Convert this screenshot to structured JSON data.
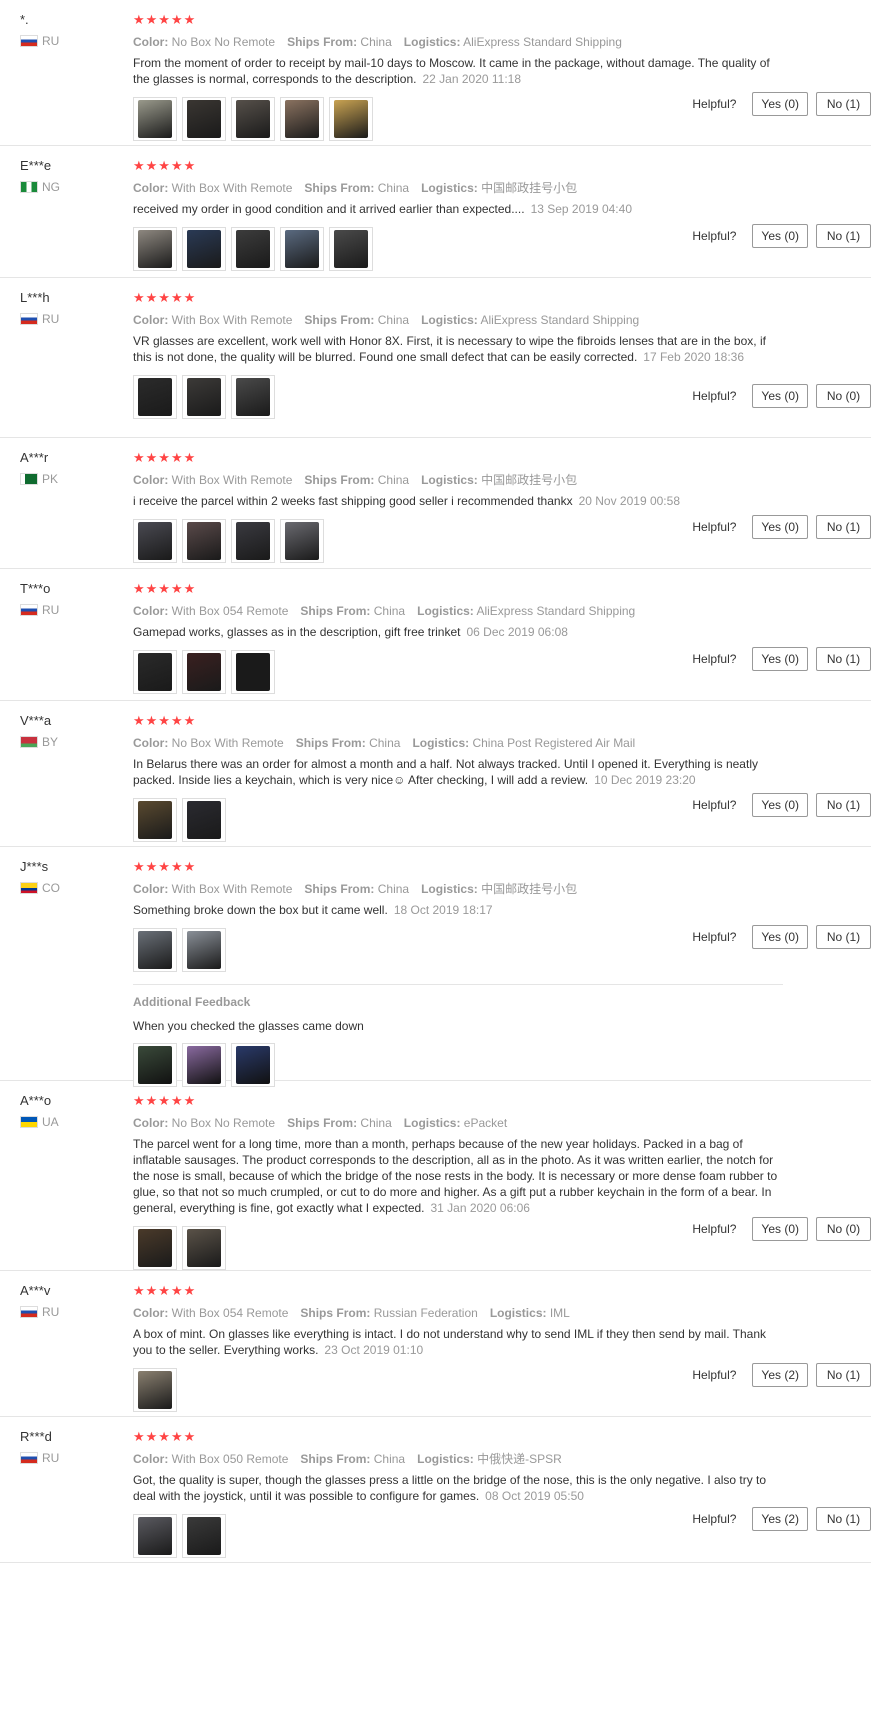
{
  "helpful_label": "Helpful?",
  "meta_labels": {
    "color": "Color:",
    "ships": "Ships From:",
    "logistics": "Logistics:"
  },
  "stars": "★★★★★",
  "reviews": [
    {
      "user": "*.",
      "country": "RU",
      "flag": [
        "#fff",
        "#1f4fb0",
        "#d52b1e"
      ],
      "color": "No Box No Remote",
      "ships": "China",
      "logistics": "AliExpress Standard Shipping",
      "text": "From the moment of order to receipt by mail-10 days to Moscow. It came in the package, without damage. The quality of the glasses is normal, corresponds to the description.",
      "date": "22 Jan 2020 11:18",
      "photos": [
        "#9a9a8c",
        "#3a3632",
        "#56504a",
        "#8a7260",
        "#c9a352"
      ],
      "yes": "Yes (0)",
      "no": "No (1)"
    },
    {
      "user": "E***e",
      "country": "NG",
      "flag": [
        "#1a8a3a",
        "#fff",
        "#1a8a3a"
      ],
      "color": "With Box With Remote",
      "ships": "China",
      "logistics": "中国邮政挂号小包",
      "text": "received my order in good condition and it arrived earlier than expected....",
      "date": "13 Sep 2019 04:40",
      "photos": [
        "#8e8880",
        "#2a3a55",
        "#3c3c3c",
        "#5a6a80",
        "#4a4a4a"
      ],
      "yes": "Yes (0)",
      "no": "No (1)"
    },
    {
      "user": "L***h",
      "country": "RU",
      "flag": [
        "#fff",
        "#1f4fb0",
        "#d52b1e"
      ],
      "color": "With Box With Remote",
      "ships": "China",
      "logistics": "AliExpress Standard Shipping",
      "text": "VR glasses are excellent, work well with Honor 8X. First, it is necessary to wipe the fibroids lenses that are in the box, if this is not done, the quality will be blurred. Found one small defect that can be easily corrected.",
      "date": "17 Feb 2020 18:36",
      "photos": [
        "#2b2b2b",
        "#3c3a38",
        "#4a4a4a"
      ],
      "yes": "Yes (0)",
      "no": "No (0)"
    },
    {
      "user": "A***r",
      "country": "PK",
      "flag": [
        "#0f6b2f",
        "#0f6b2f",
        "#0f6b2f"
      ],
      "color": "With Box With Remote",
      "ships": "China",
      "logistics": "中国邮政挂号小包",
      "text": "i receive the parcel within 2 weeks fast shipping good seller i recommended thankx",
      "date": "20 Nov 2019 00:58",
      "photos": [
        "#4a4a52",
        "#5a4a4a",
        "#3a3a40",
        "#6a6a70"
      ],
      "yes": "Yes (0)",
      "no": "No (1)"
    },
    {
      "user": "T***o",
      "country": "RU",
      "flag": [
        "#fff",
        "#1f4fb0",
        "#d52b1e"
      ],
      "color": "With Box 054 Remote",
      "ships": "China",
      "logistics": "AliExpress Standard Shipping",
      "text": "Gamepad works, glasses as in the description, gift free trinket",
      "date": "06 Dec 2019 06:08",
      "photos": [
        "#2a2a2a",
        "#3a2020",
        "#1a1a1a"
      ],
      "yes": "Yes (0)",
      "no": "No (1)"
    },
    {
      "user": "V***a",
      "country": "BY",
      "flag": [
        "#c8313e",
        "#c8313e",
        "#4aa657"
      ],
      "color": "No Box With Remote",
      "ships": "China",
      "logistics": "China Post Registered Air Mail",
      "text": "In Belarus there was an order for almost a month and a half. Not always tracked. Until I opened it. Everything is neatly packed. Inside lies a keychain, which is very nice☺ After checking, I will add a review.",
      "date": "10 Dec 2019 23:20",
      "photos": [
        "#5a4a30",
        "#2a2a30"
      ],
      "yes": "Yes (0)",
      "no": "No (1)"
    },
    {
      "user": "J***s",
      "country": "CO",
      "flag": [
        "#fcd116",
        "#003893",
        "#ce1126"
      ],
      "color": "With Box With Remote",
      "ships": "China",
      "logistics": "中国邮政挂号小包",
      "text": "Something broke down the box but it came well.",
      "date": "18 Oct 2019 18:17",
      "photos": [
        "#6a7078",
        "#8a9098"
      ],
      "yes": "Yes (0)",
      "no": "No (1)",
      "additional": {
        "title": "Additional Feedback",
        "text": "When you checked the glasses came down",
        "photos": [
          "#3a4a3a",
          "#8a6aa0",
          "#2a3a6a"
        ]
      }
    },
    {
      "user": "A***o",
      "country": "UA",
      "flag": [
        "#0057b7",
        "#0057b7",
        "#ffd700"
      ],
      "color": "No Box No Remote",
      "ships": "China",
      "logistics": "ePacket",
      "text": "The parcel went for a long time, more than a month, perhaps because of the new year holidays. Packed in a bag of inflatable sausages. The product corresponds to the description, all as in the photo. As it was written earlier, the notch for the nose is small, because of which the bridge of the nose rests in the body. It is necessary or more dense foam rubber to glue, so that not so much crumpled, or cut to do more and higher. As a gift put a rubber keychain in the form of a bear. In general, everything is fine, got exactly what I expected.",
      "date": "31 Jan 2020 06:06",
      "photos": [
        "#4a3a2a",
        "#5a5248"
      ],
      "yes": "Yes (0)",
      "no": "No (0)"
    },
    {
      "user": "A***v",
      "country": "RU",
      "flag": [
        "#fff",
        "#1f4fb0",
        "#d52b1e"
      ],
      "color": "With Box 054 Remote",
      "ships": "Russian Federation",
      "logistics": "IML",
      "text": "A box of mint. On glasses like everything is intact. I do not understand why to send IML if they then send by mail. Thank you to the seller. Everything works.",
      "date": "23 Oct 2019 01:10",
      "photos": [
        "#8a8070"
      ],
      "yes": "Yes (2)",
      "no": "No (1)"
    },
    {
      "user": "R***d",
      "country": "RU",
      "flag": [
        "#fff",
        "#1f4fb0",
        "#d52b1e"
      ],
      "color": "With Box 050 Remote",
      "ships": "China",
      "logistics": "中俄快递-SPSR",
      "text": "Got, the quality is super, though the glasses press a little on the bridge of the nose, this is the only negative. I also try to deal with the joystick, until it was possible to configure for games.",
      "date": "08 Oct 2019 05:50",
      "photos": [
        "#5a5a60",
        "#3a3a3a"
      ],
      "yes": "Yes (2)",
      "no": "No (1)"
    }
  ]
}
